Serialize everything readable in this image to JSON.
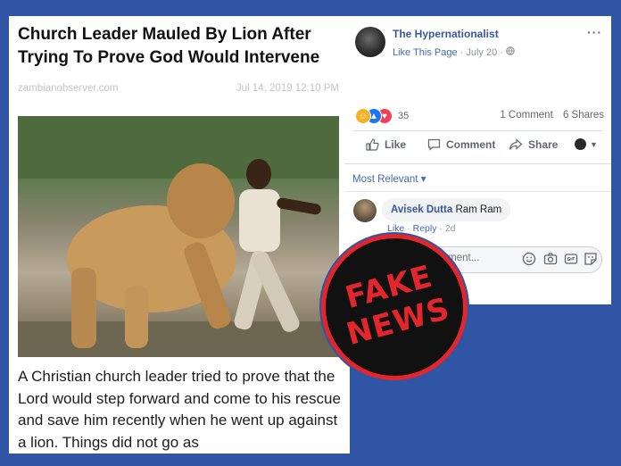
{
  "article": {
    "headline": "Church Leader Mauled By Lion After Trying To Prove God Would Intervene",
    "source": "zambianobserver.com",
    "date": "Jul 14, 2019 12:10 PM",
    "body": "A Christian church leader tried to prove that the Lord would step forward and come to his rescue and save him recently when he went up against a lion. Things did not go as"
  },
  "post": {
    "page_name": "The Hypernationalist",
    "like_page": "Like This Page",
    "post_date": "July 20",
    "separator": "·",
    "more": "···",
    "reactions": {
      "count": "35",
      "types": [
        "haha-icon",
        "like-icon",
        "love-icon"
      ],
      "colors": {
        "haha": "#f7b125",
        "like": "#1877f2",
        "love": "#f33e58"
      }
    },
    "comment_count": "1 Comment",
    "share_count": "6 Shares",
    "actions": {
      "like": "Like",
      "comment": "Comment",
      "share": "Share"
    },
    "sort_label": "Most Relevant ▾",
    "comment": {
      "author": "Avisek Dutta",
      "text": "Ram Ram",
      "like": "Like",
      "reply": "Reply",
      "time": "2d"
    },
    "compose_placeholder": "Write a comment..."
  },
  "stamp": {
    "line1": "FAKE",
    "line2": "NEWS"
  },
  "colors": {
    "background": "#2f55a4",
    "fb_link": "#385898",
    "stamp_red": "#e3262b"
  }
}
